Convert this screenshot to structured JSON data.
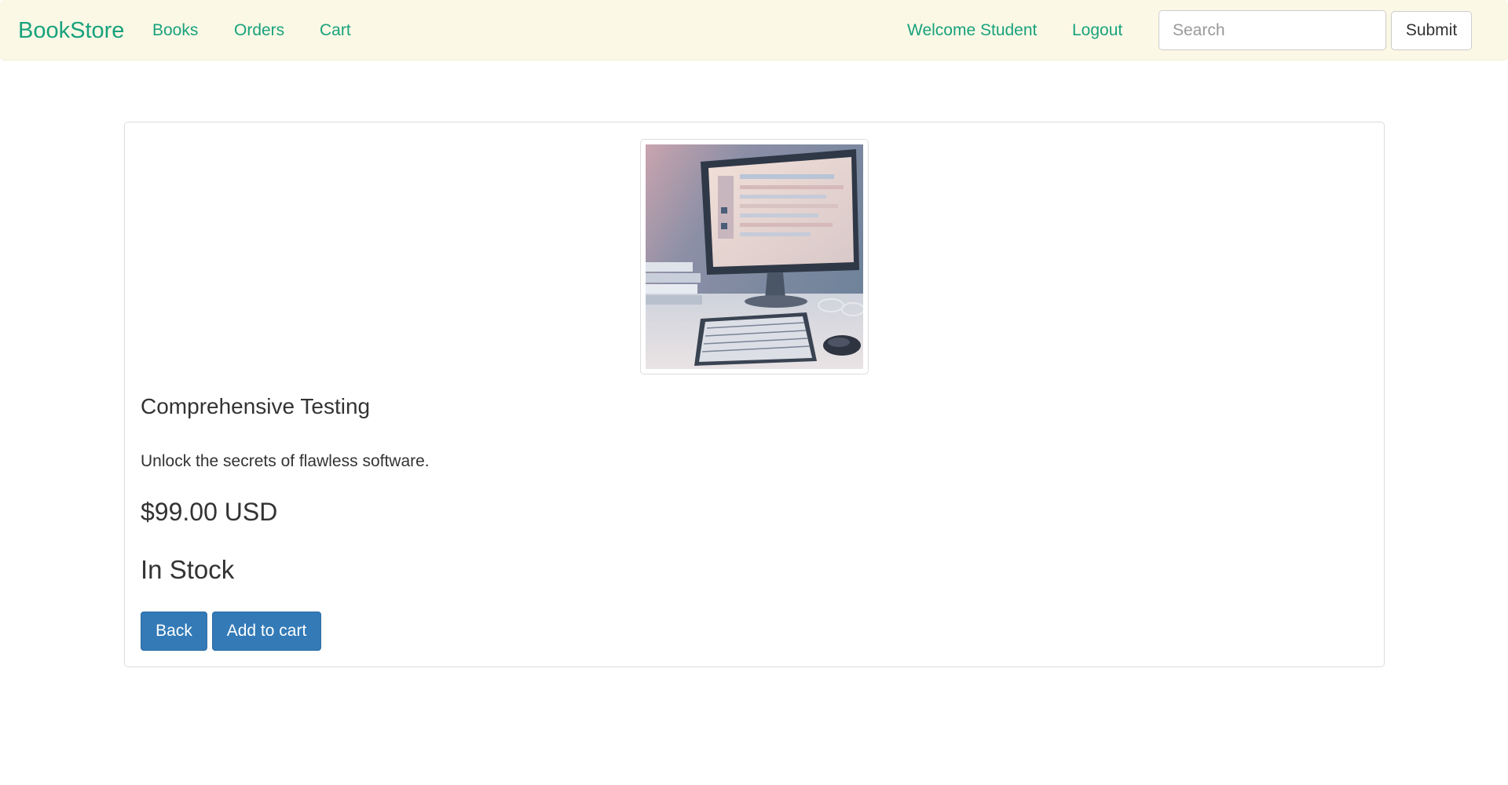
{
  "navbar": {
    "brand": "BookStore",
    "links": {
      "books": "Books",
      "orders": "Orders",
      "cart": "Cart"
    },
    "welcome": "Welcome Student",
    "logout": "Logout",
    "search": {
      "placeholder": "Search",
      "value": ""
    },
    "submit_label": "Submit"
  },
  "product": {
    "image_icon": "computer-desk-photo",
    "title": "Comprehensive Testing",
    "description": "Unlock the secrets of flawless software.",
    "price": "$99.00 USD",
    "stock_status": "In Stock"
  },
  "actions": {
    "back_label": "Back",
    "add_to_cart_label": "Add to cart"
  },
  "colors": {
    "navbar_bg": "#fcf8e6",
    "link": "#18a27c",
    "primary_button": "#337ab7"
  }
}
